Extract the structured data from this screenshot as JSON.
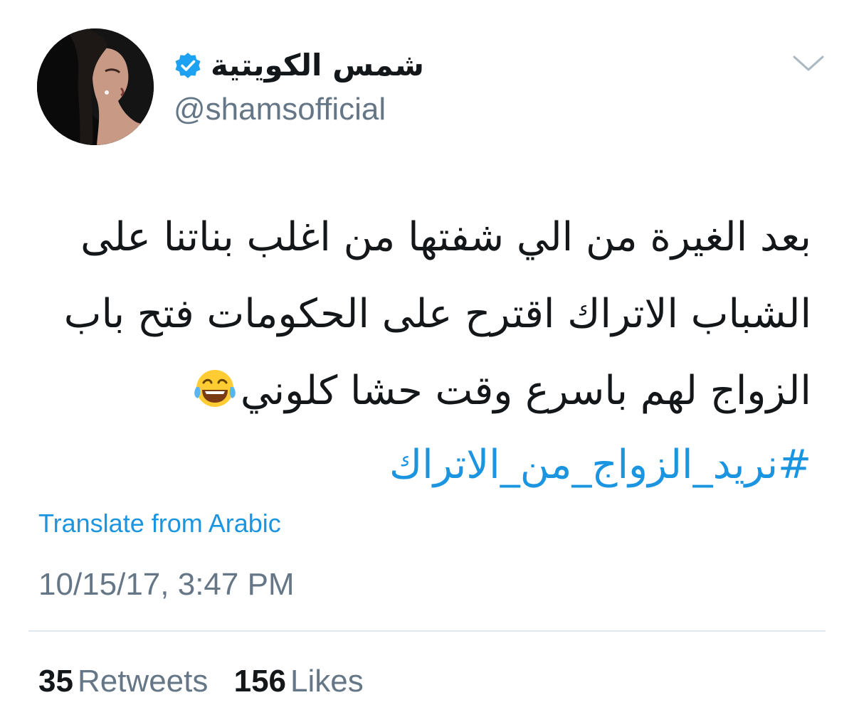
{
  "user": {
    "display_name": "شمس الكويتية",
    "handle": "@shamsofficial",
    "verified_icon": "verified-badge-icon",
    "avatar_icon": "profile-photo"
  },
  "tweet": {
    "lines": [
      "بعد الغيرة من الي شفتها من اغلب بناتنا على",
      "الشباب الاتراك  اقترح على الحكومات فتح باب",
      "الزواج لهم باسرع وقت حشا كلوني"
    ],
    "emoji": "face-with-tears-of-joy",
    "hashtag": "#نريد_الزواج_من_الاتراك"
  },
  "translate_label": "Translate from Arabic",
  "timestamp": "10/15/17, 3:47 PM",
  "stats": {
    "retweets_count": "35",
    "retweets_label": "Retweets",
    "likes_count": "156",
    "likes_label": "Likes"
  },
  "colors": {
    "link": "#1b95e0",
    "muted": "#657786",
    "text": "#14171a",
    "divider": "#e1e8ed"
  }
}
